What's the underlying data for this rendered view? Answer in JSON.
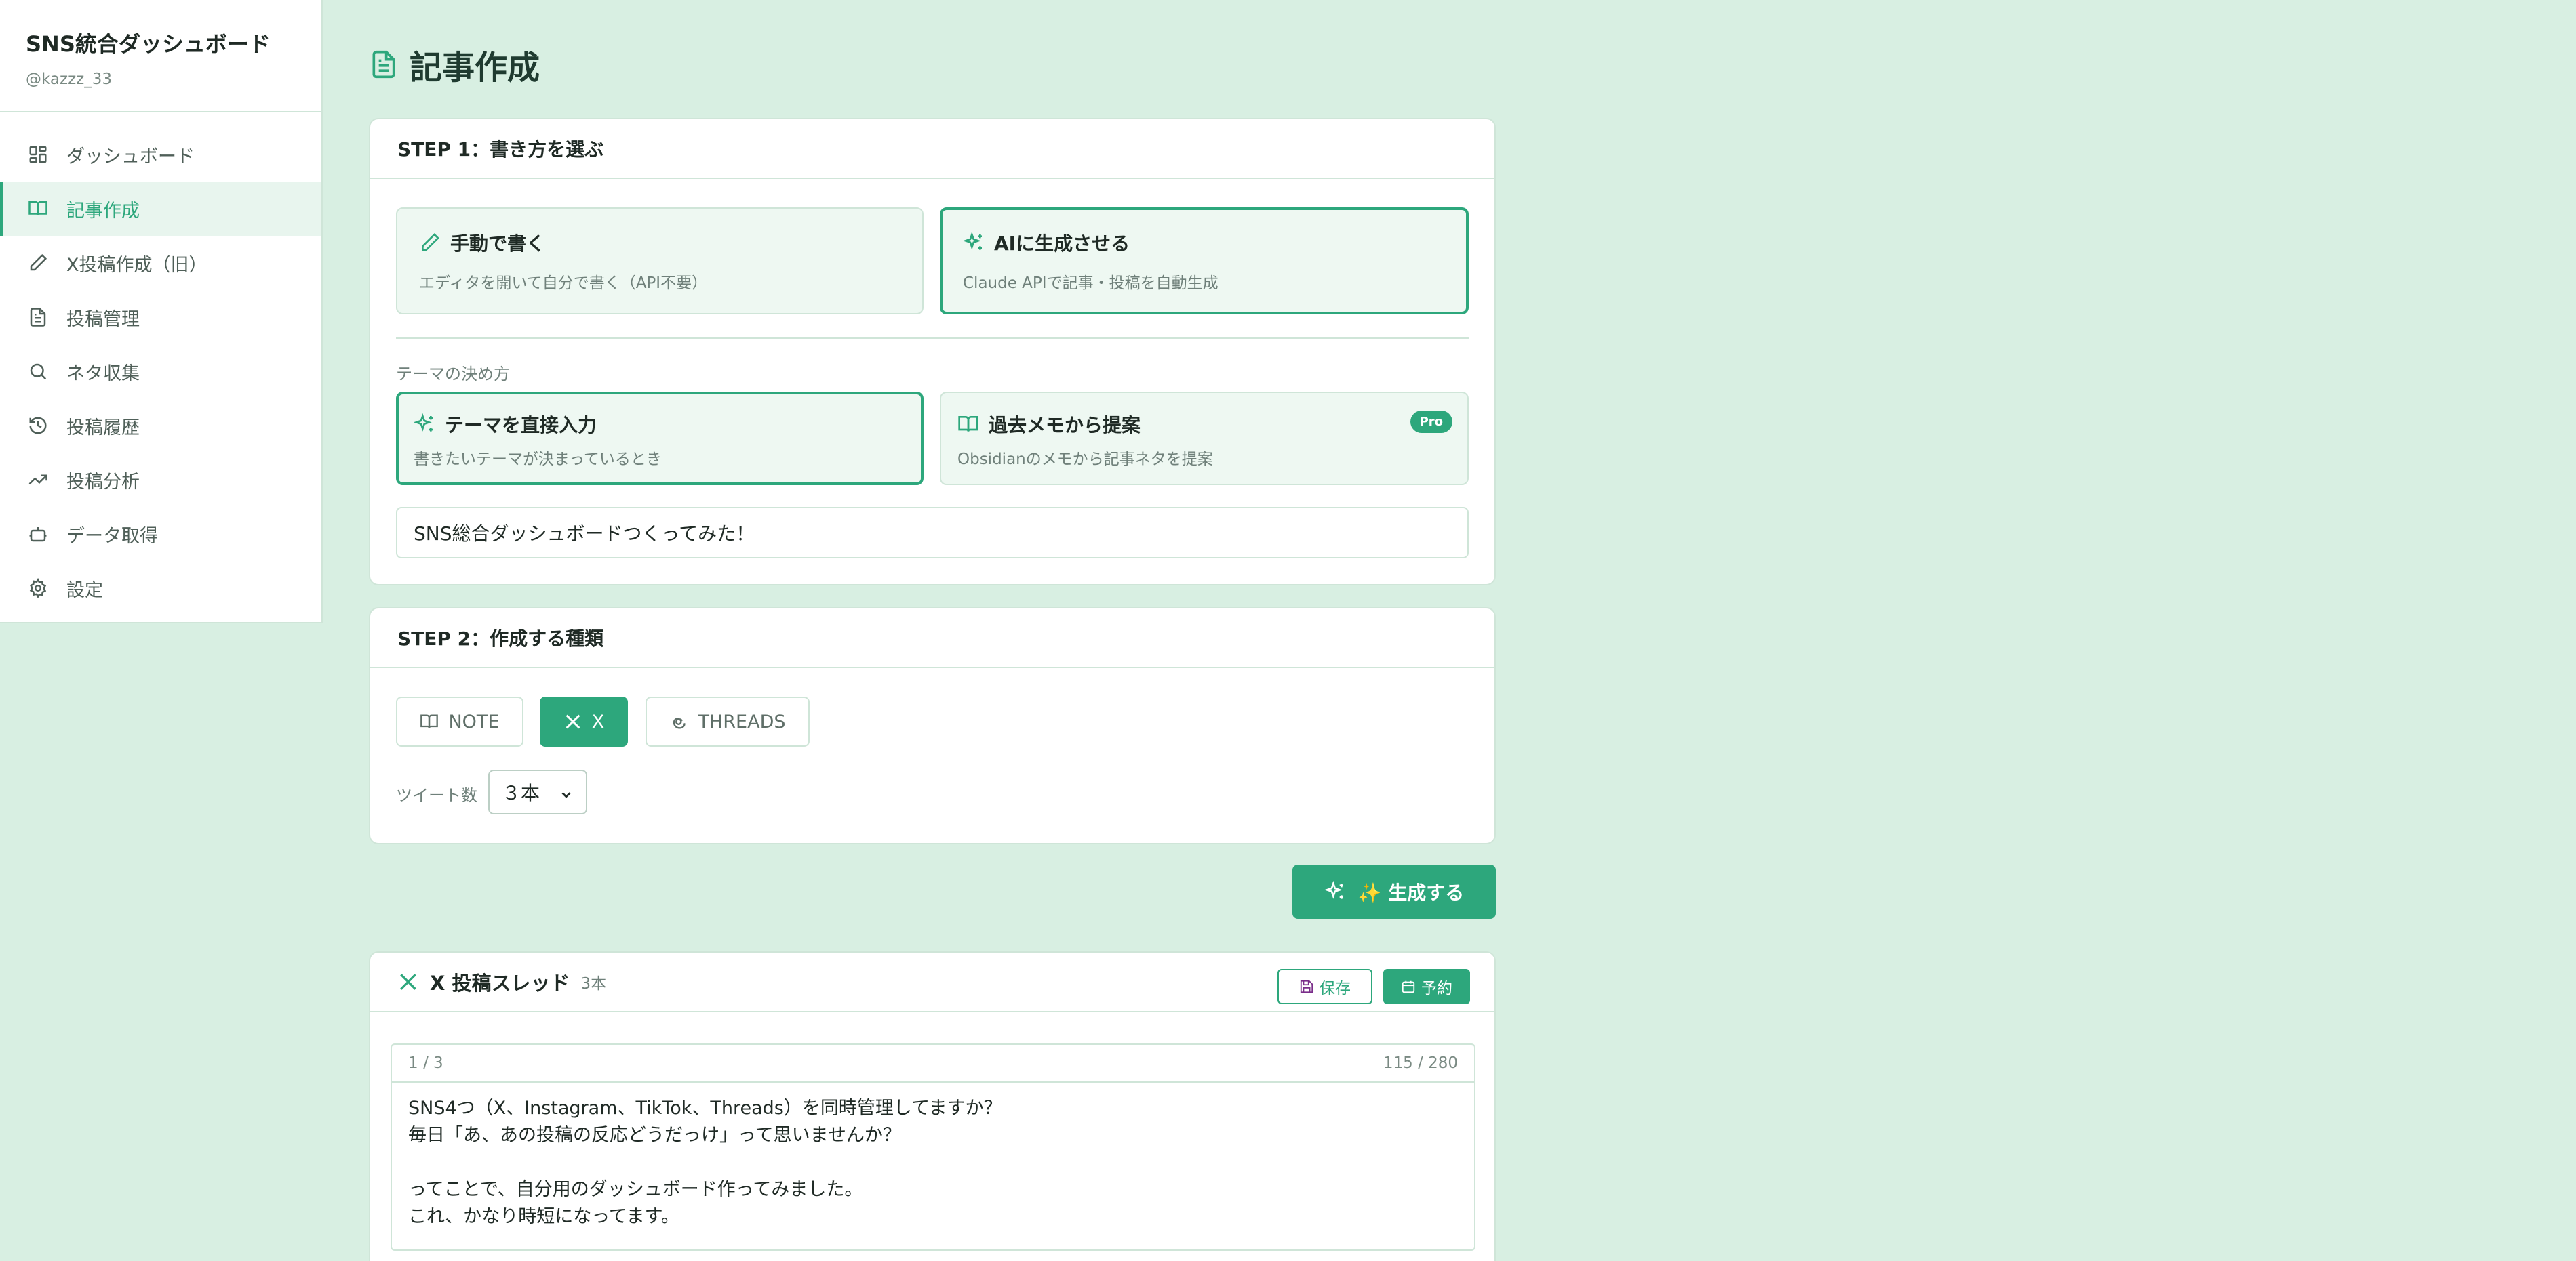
{
  "sidebar": {
    "title": "SNS統合ダッシュボード",
    "user": "@kazzz_33",
    "items": [
      {
        "label": "ダッシュボード",
        "icon": "grid-icon"
      },
      {
        "label": "記事作成",
        "icon": "book-icon",
        "active": true
      },
      {
        "label": "X投稿作成（旧）",
        "icon": "pencil-icon"
      },
      {
        "label": "投稿管理",
        "icon": "document-icon"
      },
      {
        "label": "ネタ収集",
        "icon": "search-icon"
      },
      {
        "label": "投稿履歴",
        "icon": "history-icon"
      },
      {
        "label": "投稿分析",
        "icon": "trending-icon"
      },
      {
        "label": "データ取得",
        "icon": "bot-icon"
      },
      {
        "label": "設定",
        "icon": "gear-icon"
      }
    ]
  },
  "page": {
    "title": "記事作成"
  },
  "step1": {
    "header": "STEP 1：書き方を選ぶ",
    "manual": {
      "title": "手動で書く",
      "desc": "エディタを開いて自分で書く（API不要）"
    },
    "ai": {
      "title": "AIに生成させる",
      "desc": "Claude APIで記事・投稿を自動生成"
    },
    "theme_label": "テーマの決め方",
    "direct": {
      "title": "テーマを直接入力",
      "desc": "書きたいテーマが決まっているとき"
    },
    "memo": {
      "title": "過去メモから提案",
      "desc": "Obsidianのメモから記事ネタを提案",
      "badge": "Pro"
    },
    "theme_value": "SNS総合ダッシュボードつくってみた！"
  },
  "step2": {
    "header": "STEP 2：作成する種類",
    "types": [
      "NOTE",
      "X",
      "THREADS"
    ],
    "tweet_count_label": "ツイート数",
    "tweet_count_value": "３本"
  },
  "generate_label": "✨ 生成する",
  "thread": {
    "title": "X 投稿スレッド",
    "count": "3本",
    "save": "保存",
    "schedule": "予約",
    "tweet1": {
      "index": "1 / 3",
      "chars": "115 / 280",
      "body": "SNS4つ（X、Instagram、TikTok、Threads）を同時管理してますか？\n毎日「あ、あの投稿の反応どうだっけ」って思いませんか？\n\nってことで、自分用のダッシュボード作ってみました。\nこれ、かなり時短になってます。"
    }
  },
  "colors": {
    "accent": "#2da77c",
    "background": "#d8efe2",
    "border": "#cfe5d8"
  }
}
